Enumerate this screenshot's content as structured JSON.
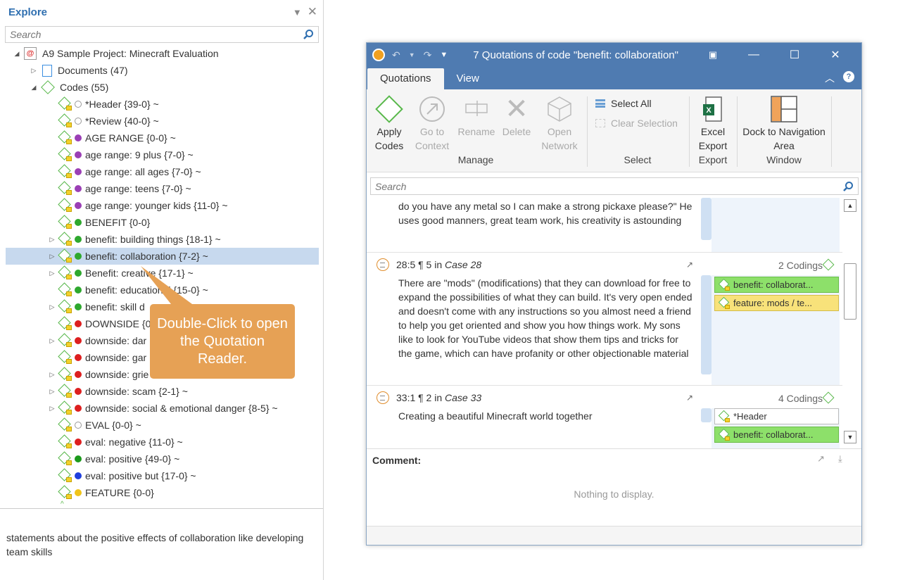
{
  "explore": {
    "title": "Explore",
    "search_placeholder": "Search",
    "tree": {
      "project": "A9 Sample Project: Minecraft Evaluation",
      "documents": "Documents (47)",
      "codes": "Codes (55)",
      "items": [
        {
          "label": "*Header {39-0} ~",
          "color": "hollow",
          "expandable": false
        },
        {
          "label": "*Review {40-0} ~",
          "color": "hollow",
          "expandable": false
        },
        {
          "label": "AGE RANGE {0-0} ~",
          "color": "#9b3fb5",
          "expandable": false
        },
        {
          "label": "age range: 9 plus {7-0} ~",
          "color": "#9b3fb5",
          "expandable": false
        },
        {
          "label": "age range: all ages {7-0} ~",
          "color": "#9b3fb5",
          "expandable": false
        },
        {
          "label": "age range: teens {7-0} ~",
          "color": "#9b3fb5",
          "expandable": false
        },
        {
          "label": "age range: younger kids {11-0} ~",
          "color": "#9b3fb5",
          "expandable": false
        },
        {
          "label": "BENEFIT {0-0}",
          "color": "#2ea82e",
          "expandable": false
        },
        {
          "label": "benefit: building things {18-1} ~",
          "color": "#2ea82e",
          "expandable": true
        },
        {
          "label": "benefit: collaboration {7-2} ~",
          "color": "#2ea82e",
          "expandable": true,
          "selected": true
        },
        {
          "label": "Benefit: creative {17-1} ~",
          "color": "#2ea82e",
          "expandable": true
        },
        {
          "label": "benefit: educational {15-0} ~",
          "color": "#2ea82e",
          "expandable": false
        },
        {
          "label": "benefit: skill d",
          "color": "#2ea82e",
          "expandable": true
        },
        {
          "label": "DOWNSIDE {0",
          "color": "#dd1f1f",
          "expandable": false
        },
        {
          "label": "downside: dar",
          "color": "#dd1f1f",
          "expandable": true
        },
        {
          "label": "downside: gar",
          "color": "#dd1f1f",
          "expandable": false
        },
        {
          "label": "downside: grie",
          "color": "#dd1f1f",
          "expandable": true
        },
        {
          "label": "downside: scam {2-1} ~",
          "color": "#dd1f1f",
          "expandable": true
        },
        {
          "label": "downside: social & emotional danger {8-5} ~",
          "color": "#dd1f1f",
          "expandable": true
        },
        {
          "label": "EVAL {0-0} ~",
          "color": "hollow",
          "expandable": false
        },
        {
          "label": "eval: negative {11-0} ~",
          "color": "#dd1f1f",
          "expandable": false
        },
        {
          "label": "eval: positive {49-0} ~",
          "color": "#1c9a1c",
          "expandable": false
        },
        {
          "label": "eval: positive but {17-0} ~",
          "color": "#1f3fdd",
          "expandable": false
        },
        {
          "label": "FEATURE {0-0}",
          "color": "#f0c419",
          "expandable": false
        }
      ]
    },
    "description": "statements about the positive effects of collaboration like developing team skills"
  },
  "callout": {
    "text": "Double-Click to open the Quotation Reader."
  },
  "window": {
    "title": "7 Quotations of code \"benefit: collaboration\"",
    "tabs": [
      {
        "label": "Quotations",
        "active": true
      },
      {
        "label": "View",
        "active": false
      }
    ],
    "ribbon": {
      "apply_codes": "Apply Codes",
      "go_to_context": "Go to Context",
      "rename": "Rename",
      "delete": "Delete",
      "open_network": "Open Network",
      "manage_group": "Manage",
      "select_all": "Select All",
      "clear_selection": "Clear Selection",
      "select_group": "Select",
      "excel_export": "Excel Export",
      "export_group": "Export",
      "dock": "Dock to Navigation Area",
      "window_group": "Window"
    },
    "search_placeholder": "Search",
    "quotations": [
      {
        "header": "",
        "text": "do you have any metal so I can make a strong pickaxe please?\" He uses good manners, great team work, his creativity is astounding",
        "codings_label": "",
        "codes": []
      },
      {
        "id": "28:5",
        "para": "¶ 5",
        "in": "in",
        "case": "Case 28",
        "text": "There are \"mods\" (modifications) that they can download for free to expand the possibilities of what they can build. It's very open ended and doesn't come with any instructions so you almost need a friend to help you get oriented and show you how things work. My sons like to look for YouTube videos that show them tips and tricks for the game, which can have profanity or other objectionable material",
        "codings_label": "2 Codings",
        "codes": [
          {
            "label": "benefit: collaborat...",
            "color": "green"
          },
          {
            "label": "feature: mods / te...",
            "color": "yellow"
          }
        ]
      },
      {
        "id": "33:1",
        "para": "¶ 2",
        "in": "in",
        "case": "Case 33",
        "text": "Creating a beautiful Minecraft world together",
        "codings_label": "4 Codings",
        "codes": [
          {
            "label": "*Header",
            "color": "white"
          },
          {
            "label": "benefit: collaborat...",
            "color": "green"
          }
        ]
      }
    ],
    "comment_label": "Comment:",
    "comment_empty": "Nothing to display."
  }
}
